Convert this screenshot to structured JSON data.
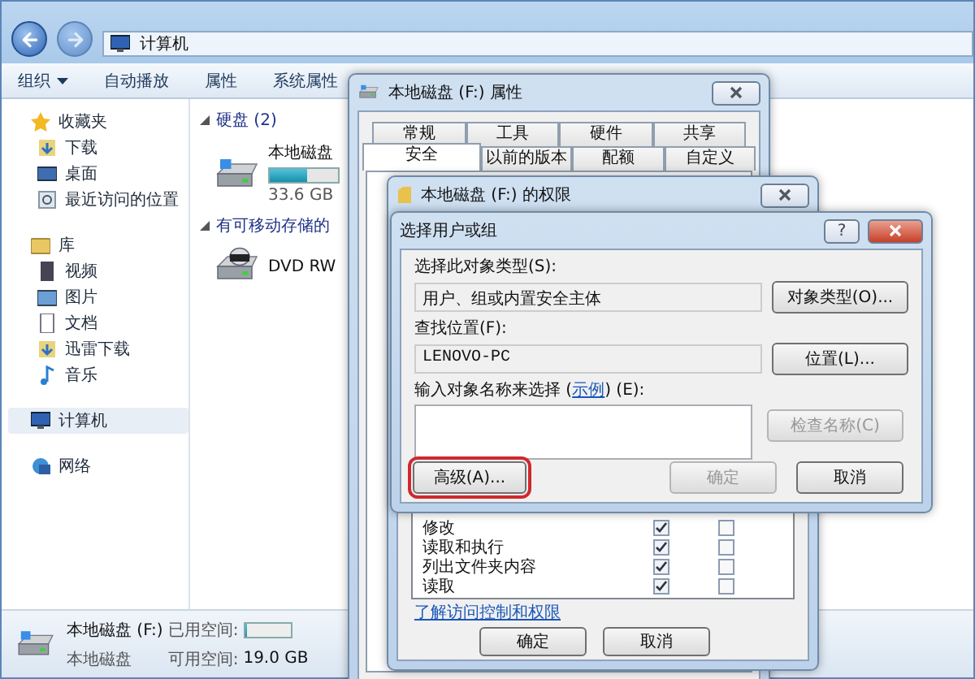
{
  "explorer": {
    "breadcrumb": [
      "计算机"
    ],
    "toolbar": [
      {
        "label": "组织",
        "kind": "menu"
      },
      {
        "label": "自动播放",
        "kind": "plain"
      },
      {
        "label": "属性",
        "kind": "plain"
      },
      {
        "label": "系统属性",
        "kind": "plain"
      }
    ],
    "sidebar": [
      {
        "label": "收藏夹",
        "selected": false,
        "children": [
          {
            "label": "下载",
            "selected": false
          },
          {
            "label": "桌面",
            "selected": false
          },
          {
            "label": "最近访问的位置",
            "selected": false
          }
        ]
      },
      {
        "label": "库",
        "selected": false,
        "children": [
          {
            "label": "视频",
            "selected": false
          },
          {
            "label": "图片",
            "selected": false
          },
          {
            "label": "文档",
            "selected": false
          },
          {
            "label": "迅雷下载",
            "selected": false
          },
          {
            "label": "音乐",
            "selected": false
          }
        ]
      },
      {
        "label": "计算机",
        "selected": true
      },
      {
        "label": "网络",
        "selected": false
      }
    ],
    "sections": [
      {
        "title": "硬盘 (2)",
        "items": [
          {
            "kind": "disk",
            "name": "本地磁盘",
            "level": 0.55,
            "detail": "33.6 GB"
          }
        ]
      },
      {
        "title": "有可移动存储的",
        "items": [
          {
            "kind": "dvd",
            "name": "DVD RW"
          }
        ]
      }
    ],
    "status": {
      "name": "本地磁盘 (F:)",
      "type": "本地磁盘",
      "used_label": "已用空间:",
      "level": 0.04,
      "free_label": "可用空间:",
      "free": "19.0 GB"
    }
  },
  "properties": {
    "title": "本地磁盘 (F:) 属性",
    "tab_rows": [
      [
        {
          "label": "常规",
          "selected": false
        },
        {
          "label": "工具",
          "selected": false
        },
        {
          "label": "硬件",
          "selected": false
        },
        {
          "label": "共享",
          "selected": false
        }
      ],
      [
        {
          "label": "安全",
          "selected": true
        },
        {
          "label": "以前的版本",
          "selected": false
        },
        {
          "label": "配额",
          "selected": false
        },
        {
          "label": "自定义",
          "selected": false
        }
      ]
    ]
  },
  "permissions": {
    "title": "本地磁盘 (F:) 的权限",
    "rows": [
      {
        "name": "修改",
        "allow": true,
        "deny": false
      },
      {
        "name": "读取和执行",
        "allow": true,
        "deny": false
      },
      {
        "name": "列出文件夹内容",
        "allow": true,
        "deny": false
      },
      {
        "name": "读取",
        "allow": true,
        "deny": false
      }
    ],
    "link": "了解访问控制和权限",
    "buttons": [
      "确定",
      "取消"
    ]
  },
  "select_dialog": {
    "title": "选择用户或组",
    "help_button": "?",
    "object_type_label": "选择此对象类型(S):",
    "object_type": "用户、组或内置安全主体",
    "object_type_button": "对象类型(O)...",
    "location_label": "查找位置(F):",
    "location": "LENOVO-PC",
    "location_button": "位置(L)...",
    "names_label_before": "输入对象名称来选择 (",
    "names_link": "示例",
    "names_label_after": ") (E):",
    "buttons": [
      {
        "label": "检查名称(C)",
        "disabled": true,
        "highlighted": false
      },
      {
        "label": "高级(A)...",
        "disabled": false,
        "highlighted": true
      },
      {
        "label": "确定",
        "disabled": true,
        "highlighted": false
      },
      {
        "label": "取消",
        "disabled": false,
        "highlighted": false
      }
    ]
  }
}
